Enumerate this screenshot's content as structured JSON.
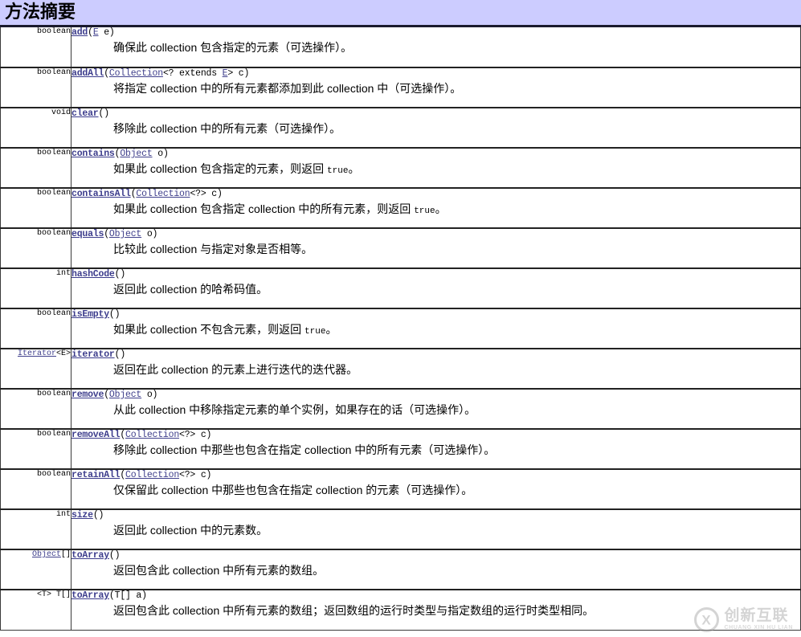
{
  "header": {
    "title": "方法摘要",
    "background_color": "#ccccff",
    "border_color": "#1a1a2e"
  },
  "colors": {
    "link": "#40408c",
    "method_link": "#3c3c8c",
    "text": "#000000",
    "table_border": "#3a3a3a"
  },
  "table": {
    "rows": [
      {
        "return_type": "boolean",
        "return_type_link": "",
        "return_type_tail": "",
        "method_name": "add",
        "params_open": "(",
        "param_link": "E",
        "param_tail": "",
        "param_name": "  e",
        "params_close": ")",
        "description": "确保此 collection 包含指定的元素（可选操作）。",
        "description_mono": ""
      },
      {
        "return_type": "boolean",
        "return_type_link": "",
        "return_type_tail": "",
        "method_name": "addAll",
        "params_open": "(",
        "param_link": "Collection",
        "param_tail": "<? extends ",
        "param_link2": "E",
        "param_tail2": ">",
        "param_name": "  c",
        "params_close": ")",
        "description": "将指定 collection 中的所有元素都添加到此 collection 中（可选操作）。",
        "description_mono": ""
      },
      {
        "return_type": "void",
        "return_type_link": "",
        "return_type_tail": "",
        "method_name": "clear",
        "params_open": "(",
        "param_link": "",
        "param_tail": "",
        "param_name": "",
        "params_close": ")",
        "description": "移除此 collection 中的所有元素（可选操作）。",
        "description_mono": ""
      },
      {
        "return_type": "boolean",
        "return_type_link": "",
        "return_type_tail": "",
        "method_name": "contains",
        "params_open": "(",
        "param_link": "Object",
        "param_tail": "",
        "param_name": "  o",
        "params_close": ")",
        "description": "如果此 collection 包含指定的元素，则返回 ",
        "description_mono": "true",
        "description_after": "。"
      },
      {
        "return_type": "boolean",
        "return_type_link": "",
        "return_type_tail": "",
        "method_name": "containsAll",
        "params_open": "(",
        "param_link": "Collection",
        "param_tail": "<?>",
        "param_name": "  c",
        "params_close": ")",
        "description": "如果此 collection 包含指定 collection 中的所有元素，则返回 ",
        "description_mono": "true",
        "description_after": "。"
      },
      {
        "return_type": "boolean",
        "return_type_link": "",
        "return_type_tail": "",
        "method_name": "equals",
        "params_open": "(",
        "param_link": "Object",
        "param_tail": "",
        "param_name": "  o",
        "params_close": ")",
        "description": "比较此 collection 与指定对象是否相等。",
        "description_mono": ""
      },
      {
        "return_type": "int",
        "return_type_link": "",
        "return_type_tail": "",
        "method_name": "hashCode",
        "params_open": "(",
        "param_link": "",
        "param_tail": "",
        "param_name": "",
        "params_close": ")",
        "description": "返回此 collection 的哈希码值。",
        "description_mono": ""
      },
      {
        "return_type": "boolean",
        "return_type_link": "",
        "return_type_tail": "",
        "method_name": "isEmpty",
        "params_open": "(",
        "param_link": "",
        "param_tail": "",
        "param_name": "",
        "params_close": ")",
        "description": "如果此 collection 不包含元素，则返回 ",
        "description_mono": "true",
        "description_after": "。"
      },
      {
        "return_type": "",
        "return_type_link": "Iterator",
        "return_type_tail": "<E>",
        "method_name": "iterator",
        "params_open": "(",
        "param_link": "",
        "param_tail": "",
        "param_name": "",
        "params_close": ")",
        "description": "返回在此 collection 的元素上进行迭代的迭代器。",
        "description_mono": ""
      },
      {
        "return_type": "boolean",
        "return_type_link": "",
        "return_type_tail": "",
        "method_name": "remove",
        "params_open": "(",
        "param_link": "Object",
        "param_tail": "",
        "param_name": "  o",
        "params_close": ")",
        "description": "从此 collection 中移除指定元素的单个实例，如果存在的话（可选操作）。",
        "description_mono": ""
      },
      {
        "return_type": "boolean",
        "return_type_link": "",
        "return_type_tail": "",
        "method_name": "removeAll",
        "params_open": "(",
        "param_link": "Collection",
        "param_tail": "<?>",
        "param_name": "  c",
        "params_close": ")",
        "description": "移除此 collection 中那些也包含在指定 collection 中的所有元素（可选操作）。",
        "description_mono": ""
      },
      {
        "return_type": "boolean",
        "return_type_link": "",
        "return_type_tail": "",
        "method_name": "retainAll",
        "params_open": "(",
        "param_link": "Collection",
        "param_tail": "<?>",
        "param_name": "  c",
        "params_close": ")",
        "description": "仅保留此 collection 中那些也包含在指定 collection 的元素（可选操作）。",
        "description_mono": ""
      },
      {
        "return_type": "int",
        "return_type_link": "",
        "return_type_tail": "",
        "method_name": "size",
        "params_open": "(",
        "param_link": "",
        "param_tail": "",
        "param_name": "",
        "params_close": ")",
        "description": "返回此 collection 中的元素数。",
        "description_mono": ""
      },
      {
        "return_type": "",
        "return_type_link": "Object",
        "return_type_tail": "[]",
        "method_name": "toArray",
        "params_open": "(",
        "param_link": "",
        "param_tail": "",
        "param_name": "",
        "params_close": ")",
        "description": "返回包含此 collection 中所有元素的数组。",
        "description_mono": ""
      },
      {
        "return_type": "<T> T[]",
        "return_type_link": "",
        "return_type_tail": "",
        "method_name": "toArray",
        "params_open": "(",
        "param_link": "",
        "param_tail": "T[]",
        "param_name": "  a",
        "params_close": ")",
        "description": "返回包含此 collection 中所有元素的数组；返回数组的运行时类型与指定数组的运行时类型相同。",
        "description_mono": ""
      }
    ]
  },
  "watermark": {
    "mark": "CX",
    "cn_text": "创新互联",
    "en_text": "CHUANG XIN HU LIAN"
  }
}
